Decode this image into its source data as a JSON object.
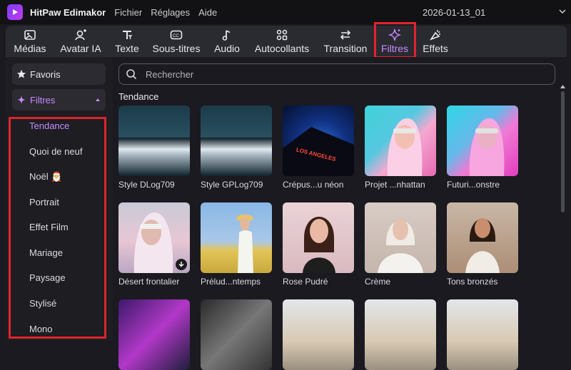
{
  "app": {
    "name": "HitPaw Edimakor",
    "menu": [
      "Fichier",
      "Réglages",
      "Aide"
    ],
    "project": "2026-01-13_01"
  },
  "toolbar": {
    "tabs": [
      {
        "label": "Médias",
        "icon": "image-icon"
      },
      {
        "label": "Avatar IA",
        "icon": "avatar-ai-icon"
      },
      {
        "label": "Texte",
        "icon": "text-icon"
      },
      {
        "label": "Sous-titres",
        "icon": "subtitles-icon"
      },
      {
        "label": "Audio",
        "icon": "music-note-icon"
      },
      {
        "label": "Autocollants",
        "icon": "stickers-icon"
      },
      {
        "label": "Transition",
        "icon": "transition-icon"
      },
      {
        "label": "Filtres",
        "icon": "sparkle-icon",
        "active": true
      },
      {
        "label": "Effets",
        "icon": "effects-icon"
      }
    ]
  },
  "sidebar": {
    "favorites": "Favoris",
    "filters": "Filtres",
    "items": [
      {
        "label": "Tendance",
        "active": true
      },
      {
        "label": "Quoi de neuf"
      },
      {
        "label": "Noël 🎅"
      },
      {
        "label": "Portrait"
      },
      {
        "label": "Effet Film"
      },
      {
        "label": "Mariage"
      },
      {
        "label": "Paysage"
      },
      {
        "label": "Stylisé"
      },
      {
        "label": "Mono"
      }
    ]
  },
  "search": {
    "placeholder": "Rechercher"
  },
  "section": {
    "title": "Tendance"
  },
  "filters": [
    {
      "name": "Style DLog709"
    },
    {
      "name": "Style GPLog709"
    },
    {
      "name": "Crépus...u néon"
    },
    {
      "name": "Projet ...nhattan"
    },
    {
      "name": "Futuri...onstre"
    },
    {
      "name": "Désert frontalier",
      "download": true
    },
    {
      "name": "Prélud...ntemps"
    },
    {
      "name": "Rose Pudré"
    },
    {
      "name": "Crème"
    },
    {
      "name": "Tons bronzés"
    }
  ],
  "thumb_text": "LOS ANGELES",
  "colors": {
    "accent": "#c88bff",
    "highlight": "#e0242c"
  }
}
